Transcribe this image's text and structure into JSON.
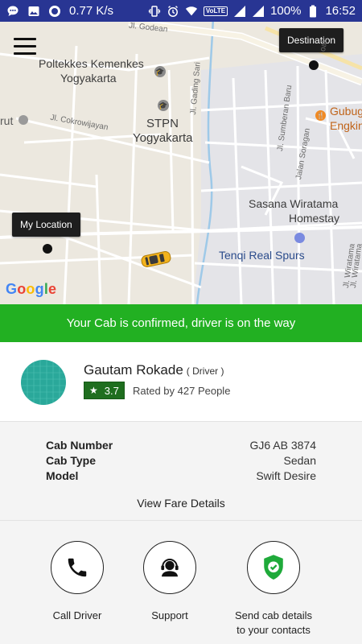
{
  "status_bar": {
    "speed": "0.77 K/s",
    "network_badge": "VoLTE",
    "battery": "100%",
    "time": "16:52",
    "icons": [
      "chat-icon",
      "gallery-icon",
      "circle-app-icon",
      "vibrate-icon",
      "alarm-icon",
      "wifi-icon",
      "signal-icon",
      "signal-icon-2",
      "battery-icon"
    ]
  },
  "map": {
    "destination_label": "Destination",
    "my_location_label": "My Location",
    "google_logo": "Google",
    "places": {
      "poltekkes_1": "Poltekkes Kemenkes",
      "poltekkes_2": "Yogyakarta",
      "stpn_1": "STPN",
      "stpn_2": "Yogyakarta",
      "sasana_1": "Sasana Wiratama",
      "sasana_2": "Homestay",
      "tenqi": "Tenqi Real Spurs",
      "gubug_1": "Gubug",
      "gubug_2": "Engkin",
      "rut": "rut"
    },
    "streets": {
      "godean": "Jl. Godean",
      "cokrowijayan": "Jl. Cokrowijayan",
      "gading_sari": "Jl. Gading Sari",
      "sumberan_baru": "Jl. Sumberan Baru",
      "soragan": "Jalan Soragan",
      "wiratama_1": "Jl. Wiratama",
      "wiratama_2": "Jl. Wiratama",
      "roak": "oak"
    }
  },
  "banner": {
    "message": "Your Cab is confirmed, driver is on the way",
    "color": "#22b022"
  },
  "driver": {
    "name": "Gautam Rokade",
    "role": "( Driver )",
    "rating": "3.7",
    "rated_by": "Rated by 427 People"
  },
  "cab": {
    "rows": [
      {
        "key": "Cab Number",
        "value": "GJ6 AB 3874"
      },
      {
        "key": "Cab Type",
        "value": "Sedan"
      },
      {
        "key": "Model",
        "value": "Swift Desire"
      }
    ],
    "fare_link": "View Fare Details"
  },
  "actions": {
    "call_driver": "Call Driver",
    "support": "Support",
    "send_details_line1": "Send cab details",
    "send_details_line2": "to your contacts"
  }
}
